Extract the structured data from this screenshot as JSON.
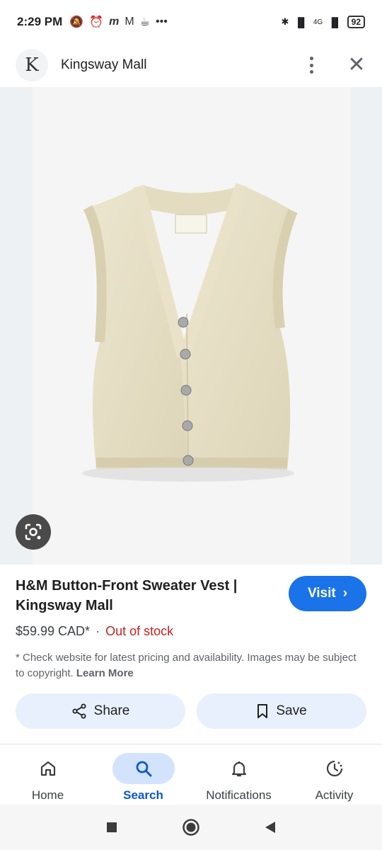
{
  "status_bar": {
    "time": "2:29 PM",
    "overflow": "•••",
    "signal_label": "4G",
    "battery": "92"
  },
  "header": {
    "logo_letter": "K",
    "site_name": "Kingsway Mall"
  },
  "product": {
    "title": "H&M Button-Front Sweater Vest | Kingsway Mall",
    "price": "$59.99 CAD*",
    "separator": "·",
    "stock_status": "Out of stock",
    "disclaimer": "* Check website for latest pricing and availability. Images may be subject to copyright.",
    "learn_more": "Learn More",
    "image_desc_label": "vest-product-image"
  },
  "actions": {
    "visit_label": "Visit",
    "share_label": "Share",
    "save_label": "Save"
  },
  "bottom_nav": {
    "items": [
      {
        "label": "Home",
        "icon": "home-icon",
        "active": false
      },
      {
        "label": "Search",
        "icon": "search-icon",
        "active": true
      },
      {
        "label": "Notifications",
        "icon": "bell-icon",
        "active": false
      },
      {
        "label": "Activity",
        "icon": "activity-icon",
        "active": false
      }
    ]
  },
  "colors": {
    "accent": "#1a73e8",
    "out_of_stock": "#c5221f",
    "pill_bg": "#e8f0fe",
    "active_nav_bg": "#d3e3fd"
  }
}
